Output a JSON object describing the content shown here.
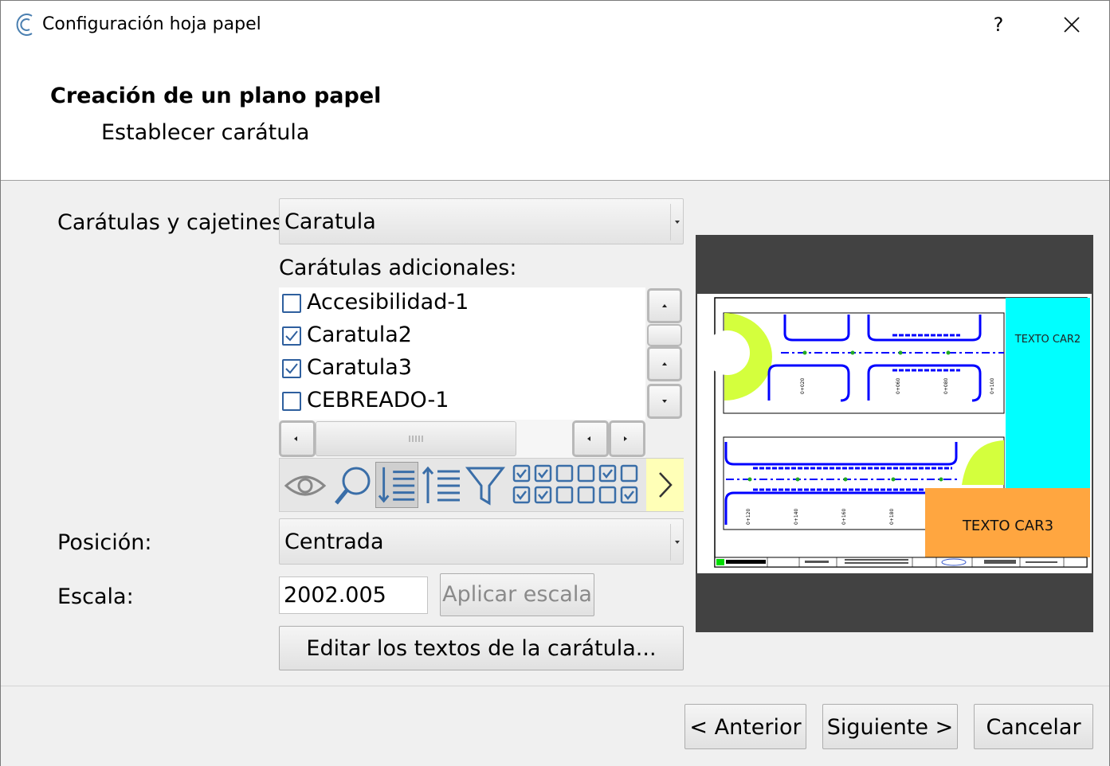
{
  "window": {
    "title": "Configuración hoja papel",
    "help": "?"
  },
  "header": {
    "title": "Creación de un plano papel",
    "subtitle": "Establecer carátula"
  },
  "form": {
    "caratulas_label": "Carátulas y cajetines",
    "caratulas_value": "Caratula",
    "adicionales_label": "Carátulas adicionales:",
    "adicionales_items": [
      {
        "label": "Accesibilidad-1",
        "checked": false
      },
      {
        "label": "Caratula2",
        "checked": true
      },
      {
        "label": "Caratula3",
        "checked": true
      },
      {
        "label": "CEBREADO-1",
        "checked": false
      }
    ],
    "posicion_label": "Posición:",
    "posicion_value": "Centrada",
    "escala_label": "Escala:",
    "escala_value": "2002.005",
    "aplicar_label": "Aplicar escala",
    "editar_label": "Editar los textos de la carátula..."
  },
  "toolbar": {
    "icons": [
      "eye-icon",
      "search-icon",
      "sort-descending-icon",
      "sort-ascending-icon",
      "filter-icon",
      "check-all-icon",
      "uncheck-all-icon",
      "check-grid-icon",
      "next-icon"
    ]
  },
  "preview": {
    "car2_text": "TEXTO CAR2",
    "car3_text": "TEXTO CAR3",
    "station_labels": [
      "0+020",
      "0+060",
      "0+080",
      "0+100",
      "0+120",
      "0+140",
      "0+160",
      "0+180"
    ],
    "colors": {
      "background": "#424242",
      "car2": "#00ffff",
      "car3": "#ffa640",
      "road": "#0000ff",
      "lime": "#d4ff3d"
    }
  },
  "footer": {
    "anterior_label": "< Anterior",
    "siguiente_label": "Siguiente >",
    "cancelar_label": "Cancelar"
  }
}
